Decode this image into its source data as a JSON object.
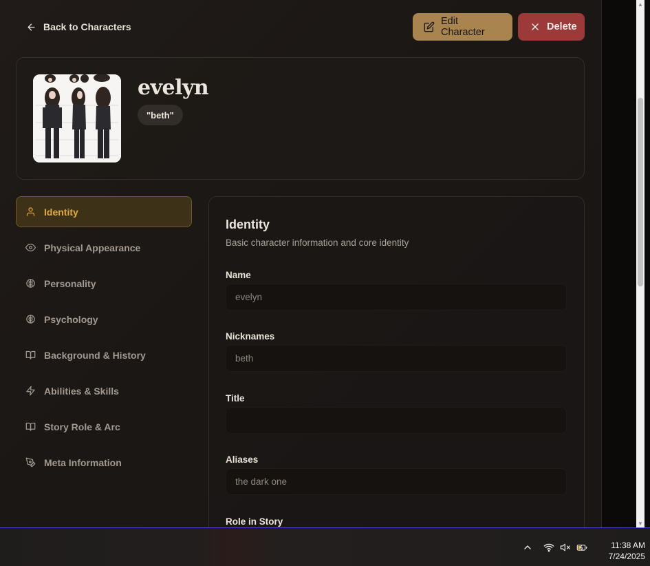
{
  "topbar": {
    "back_label": "Back to Characters",
    "edit_label": "Edit Character",
    "delete_label": "Delete"
  },
  "character": {
    "name": "evelyn",
    "nickname_badge": "\"beth\""
  },
  "nav": {
    "items": [
      {
        "label": "Identity",
        "icon": "user-icon",
        "active": true
      },
      {
        "label": "Physical Appearance",
        "icon": "eye-icon",
        "active": false
      },
      {
        "label": "Personality",
        "icon": "brain-icon",
        "active": false
      },
      {
        "label": "Psychology",
        "icon": "brain-icon",
        "active": false
      },
      {
        "label": "Background & History",
        "icon": "book-open-icon",
        "active": false
      },
      {
        "label": "Abilities & Skills",
        "icon": "zap-icon",
        "active": false
      },
      {
        "label": "Story Role & Arc",
        "icon": "book-open-icon",
        "active": false
      },
      {
        "label": "Meta Information",
        "icon": "pen-tool-icon",
        "active": false
      }
    ]
  },
  "section": {
    "title": "Identity",
    "description": "Basic character information and core identity",
    "fields": [
      {
        "label": "Name",
        "value": "evelyn",
        "placeholder": ""
      },
      {
        "label": "Nicknames",
        "value": "beth",
        "placeholder": ""
      },
      {
        "label": "Title",
        "value": "",
        "placeholder": ""
      },
      {
        "label": "Aliases",
        "value": "the dark one",
        "placeholder": ""
      },
      {
        "label": "Role in Story",
        "value": "",
        "placeholder": ""
      }
    ]
  },
  "taskbar": {
    "time": "11:38 AM",
    "date": "7/24/2025"
  },
  "colors": {
    "accent_gold": "#a8844e",
    "danger": "#9b3a38",
    "active_nav": "#e2a93a"
  }
}
